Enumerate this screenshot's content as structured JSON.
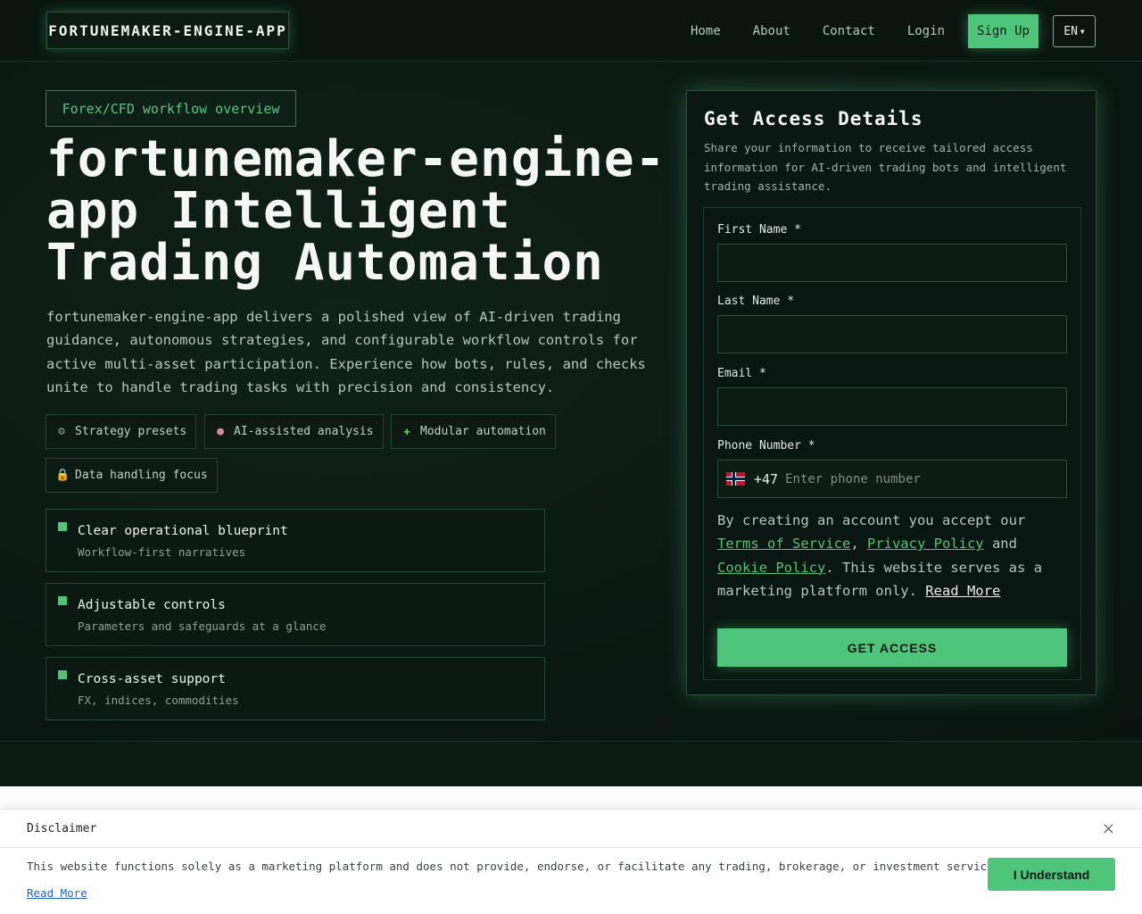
{
  "header": {
    "logo": "FORTUNEMAKER-ENGINE-APP",
    "nav": [
      "Home",
      "About",
      "Contact",
      "Login"
    ],
    "signup": "Sign Up",
    "lang": "EN"
  },
  "hero": {
    "tag": "Forex/CFD workflow overview",
    "title": "fortunemaker-engine-app Intelligent Trading Automation",
    "description": "fortunemaker-engine-app delivers a polished view of AI-driven trading guidance, autonomous strategies, and configurable workflow controls for active multi-asset participation. Experience how bots, rules, and checks unite to handle trading tasks with precision and consistency.",
    "chips": [
      {
        "icon": "gear-icon",
        "glyph": "⚙",
        "label": "Strategy presets"
      },
      {
        "icon": "brain-icon",
        "glyph": "●",
        "label": "AI-assisted analysis"
      },
      {
        "icon": "puzzle-icon",
        "glyph": "✚",
        "label": "Modular automation"
      },
      {
        "icon": "lock-icon",
        "glyph": "🔒",
        "label": "Data handling focus"
      }
    ],
    "features": [
      {
        "title": "Clear operational blueprint",
        "subtitle": "Workflow-first narratives"
      },
      {
        "title": "Adjustable controls",
        "subtitle": "Parameters and safeguards at a glance"
      },
      {
        "title": "Cross-asset support",
        "subtitle": "FX, indices, commodities"
      }
    ]
  },
  "form": {
    "title": "Get Access Details",
    "subtitle": "Share your information to receive tailored access information for AI-driven trading bots and intelligent trading assistance.",
    "first_name_label": "First Name *",
    "last_name_label": "Last Name *",
    "email_label": "Email *",
    "phone_label": "Phone Number *",
    "dial_code": "+47",
    "phone_placeholder": "Enter phone number",
    "terms_prefix": "By creating an account you accept our ",
    "terms_link": "Terms of Service",
    "terms_sep": ", ",
    "privacy_link": "Privacy Policy",
    "terms_and": " and ",
    "cookie_link": "Cookie Policy",
    "terms_suffix": ". This website serves as a marketing platform only. ",
    "read_more": "Read More",
    "submit": "GET ACCESS"
  },
  "disclaimer": {
    "title": "Disclaimer",
    "close": "×",
    "text": "This website functions solely as a marketing platform and does not provide, endorse, or facilitate any trading, brokerage, or investment services.",
    "read_more": "Read More",
    "button": "I Understand"
  },
  "colors": {
    "accent": "#4ec57a",
    "background": "#0b1712"
  }
}
